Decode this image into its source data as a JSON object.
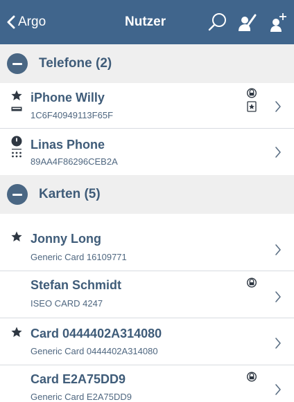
{
  "colors": {
    "navbar": "#40658c",
    "section_bg": "#efefef",
    "text": "#3f5c79"
  },
  "navbar": {
    "back_label": "Argo",
    "title": "Nutzer",
    "icons": [
      "search-icon",
      "edit-user-icon",
      "add-user-icon"
    ]
  },
  "sections": [
    {
      "title": "Telefone (2)",
      "items": [
        {
          "name": "iPhone Willy",
          "detail": "1C6F40949113F65F",
          "icons": [
            "star-icon",
            "phone-badge-icon",
            "lock-icon",
            "card-badge-icon"
          ]
        },
        {
          "name": "Linas Phone",
          "detail": "89AA4F86296CEB2A",
          "icons": [
            "clock-icon",
            "keypad-icon"
          ]
        }
      ]
    },
    {
      "title": "Karten (5)",
      "items": [
        {
          "name": "Jonny Long",
          "detail": "Generic Card 16109771",
          "icons": [
            "star-icon"
          ]
        },
        {
          "name": "Stefan Schmidt",
          "detail": "ISEO CARD 4247",
          "icons": [
            "lock-icon"
          ]
        },
        {
          "name": "Card 0444402A314080",
          "detail": "Generic Card 0444402A314080",
          "icons": [
            "star-icon"
          ]
        },
        {
          "name": "Card E2A75DD9",
          "detail": "Generic Card E2A75DD9",
          "icons": [
            "lock-icon"
          ]
        }
      ]
    }
  ]
}
